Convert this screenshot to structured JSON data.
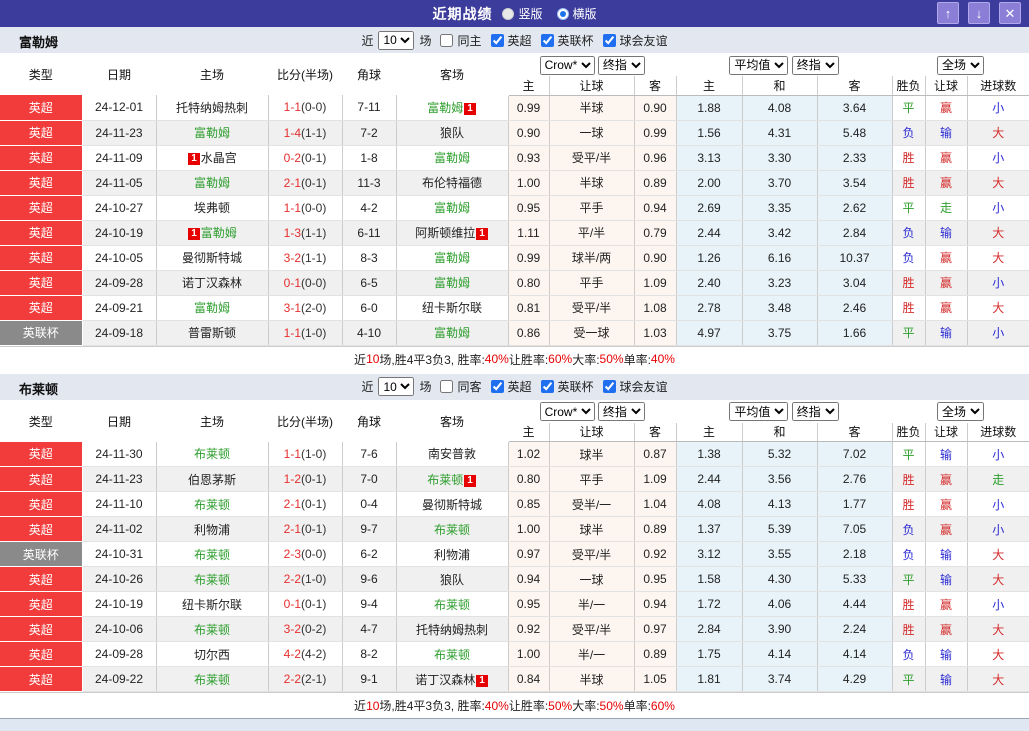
{
  "title_bar": {
    "title": "近期战绩",
    "radios": [
      {
        "label": "竖版",
        "checked": false
      },
      {
        "label": "横版",
        "checked": true
      }
    ],
    "buttons": {
      "up": "↑",
      "down": "↓",
      "close": "✕"
    }
  },
  "colors": {
    "titlebar_bg": "#3c3c9c",
    "epl_red": "#f23c3c",
    "cup_gray": "#8a8a8a",
    "team_green": "#2e9e2e",
    "score_red": "#e62e2e",
    "badge_red": "#e60000",
    "win_red": "#d42b2b",
    "draw_green": "#2e9e2e",
    "lose_blue": "#2b2bd4",
    "odds_bg": "#fdf6f0",
    "avg_bg": "#e7f3f9",
    "header_bg": "#d9e0eb"
  },
  "table_headers": {
    "type": "类型",
    "date": "日期",
    "home": "主场",
    "score": "比分(半场)",
    "corner": "角球",
    "away": "客场",
    "odds_home": "主",
    "odds_handicap": "让球",
    "odds_away": "客",
    "avg_home": "主",
    "avg_draw": "和",
    "avg_away": "客",
    "result_wdl": "胜负",
    "result_handicap": "让球",
    "result_goals": "进球数"
  },
  "dropdowns": {
    "count": "10",
    "bookmaker": "Crow*",
    "final_odds": "终指",
    "average": "平均值",
    "final_odds2": "终指",
    "full_match": "全场"
  },
  "result_color_map": {
    "胜": "#d42b2b",
    "平": "#2e9e2e",
    "负": "#2b2bd4",
    "赢": "#d42b2b",
    "输": "#2b2bd4",
    "走": "#2e9e2e",
    "大": "#d42b2b",
    "小": "#2b2bd4"
  },
  "sections": [
    {
      "team": "富勒姆",
      "near_label": "近",
      "games_label": "场",
      "same_side_label": "同主",
      "same_side_checked": false,
      "leagues": [
        {
          "label": "英超",
          "checked": true
        },
        {
          "label": "英联杯",
          "checked": true
        },
        {
          "label": "球会友谊",
          "checked": true
        }
      ],
      "rows": [
        {
          "type": "英超",
          "date": "24-12-01",
          "home": "托特纳姆热刺",
          "home_color": "black",
          "home_badge": false,
          "score": "1-1",
          "half": "(0-0)",
          "corner": "7-11",
          "away": "富勒姆",
          "away_color": "green",
          "away_badge": true,
          "odds": [
            "0.99",
            "半球",
            "0.90"
          ],
          "avg": [
            "1.88",
            "4.08",
            "3.64"
          ],
          "results": [
            "平",
            "赢",
            "小"
          ]
        },
        {
          "type": "英超",
          "date": "24-11-23",
          "home": "富勒姆",
          "home_color": "green",
          "home_badge": false,
          "score": "1-4",
          "half": "(1-1)",
          "corner": "7-2",
          "away": "狼队",
          "away_color": "black",
          "away_badge": false,
          "odds": [
            "0.90",
            "一球",
            "0.99"
          ],
          "avg": [
            "1.56",
            "4.31",
            "5.48"
          ],
          "results": [
            "负",
            "输",
            "大"
          ]
        },
        {
          "type": "英超",
          "date": "24-11-09",
          "home": "水晶宫",
          "home_color": "black",
          "home_badge": true,
          "score": "0-2",
          "half": "(0-1)",
          "corner": "1-8",
          "away": "富勒姆",
          "away_color": "green",
          "away_badge": false,
          "odds": [
            "0.93",
            "受平/半",
            "0.96"
          ],
          "avg": [
            "3.13",
            "3.30",
            "2.33"
          ],
          "results": [
            "胜",
            "赢",
            "小"
          ]
        },
        {
          "type": "英超",
          "date": "24-11-05",
          "home": "富勒姆",
          "home_color": "green",
          "home_badge": false,
          "score": "2-1",
          "half": "(0-1)",
          "corner": "11-3",
          "away": "布伦特福德",
          "away_color": "black",
          "away_badge": false,
          "odds": [
            "1.00",
            "半球",
            "0.89"
          ],
          "avg": [
            "2.00",
            "3.70",
            "3.54"
          ],
          "results": [
            "胜",
            "赢",
            "大"
          ]
        },
        {
          "type": "英超",
          "date": "24-10-27",
          "home": "埃弗顿",
          "home_color": "black",
          "home_badge": false,
          "score": "1-1",
          "half": "(0-0)",
          "corner": "4-2",
          "away": "富勒姆",
          "away_color": "green",
          "away_badge": false,
          "odds": [
            "0.95",
            "平手",
            "0.94"
          ],
          "avg": [
            "2.69",
            "3.35",
            "2.62"
          ],
          "results": [
            "平",
            "走",
            "小"
          ]
        },
        {
          "type": "英超",
          "date": "24-10-19",
          "home": "富勒姆",
          "home_color": "green",
          "home_badge": true,
          "score": "1-3",
          "half": "(1-1)",
          "corner": "6-11",
          "away": "阿斯顿维拉",
          "away_color": "black",
          "away_badge": true,
          "odds": [
            "1.11",
            "平/半",
            "0.79"
          ],
          "avg": [
            "2.44",
            "3.42",
            "2.84"
          ],
          "results": [
            "负",
            "输",
            "大"
          ]
        },
        {
          "type": "英超",
          "date": "24-10-05",
          "home": "曼彻斯特城",
          "home_color": "black",
          "home_badge": false,
          "score": "3-2",
          "half": "(1-1)",
          "corner": "8-3",
          "away": "富勒姆",
          "away_color": "green",
          "away_badge": false,
          "odds": [
            "0.99",
            "球半/两",
            "0.90"
          ],
          "avg": [
            "1.26",
            "6.16",
            "10.37"
          ],
          "results": [
            "负",
            "赢",
            "大"
          ]
        },
        {
          "type": "英超",
          "date": "24-09-28",
          "home": "诺丁汉森林",
          "home_color": "black",
          "home_badge": false,
          "score": "0-1",
          "half": "(0-0)",
          "corner": "6-5",
          "away": "富勒姆",
          "away_color": "green",
          "away_badge": false,
          "odds": [
            "0.80",
            "平手",
            "1.09"
          ],
          "avg": [
            "2.40",
            "3.23",
            "3.04"
          ],
          "results": [
            "胜",
            "赢",
            "小"
          ]
        },
        {
          "type": "英超",
          "date": "24-09-21",
          "home": "富勒姆",
          "home_color": "green",
          "home_badge": false,
          "score": "3-1",
          "half": "(2-0)",
          "corner": "6-0",
          "away": "纽卡斯尔联",
          "away_color": "black",
          "away_badge": false,
          "odds": [
            "0.81",
            "受平/半",
            "1.08"
          ],
          "avg": [
            "2.78",
            "3.48",
            "2.46"
          ],
          "results": [
            "胜",
            "赢",
            "大"
          ]
        },
        {
          "type": "英联杯",
          "date": "24-09-18",
          "home": "普雷斯顿",
          "home_color": "black",
          "home_badge": false,
          "score": "1-1",
          "half": "(1-0)",
          "corner": "4-10",
          "away": "富勒姆",
          "away_color": "green",
          "away_badge": false,
          "odds": [
            "0.86",
            "受一球",
            "1.03"
          ],
          "avg": [
            "4.97",
            "3.75",
            "1.66"
          ],
          "results": [
            "平",
            "输",
            "小"
          ]
        }
      ],
      "summary": [
        {
          "t": "近"
        },
        {
          "t": "10",
          "red": true
        },
        {
          "t": "场,胜4平3负3, 胜率:"
        },
        {
          "t": "40%",
          "red": true
        },
        {
          "t": " 让胜率:"
        },
        {
          "t": "60%",
          "red": true
        },
        {
          "t": " 大率:"
        },
        {
          "t": "50%",
          "red": true
        },
        {
          "t": " 单率:"
        },
        {
          "t": "40%",
          "red": true
        }
      ]
    },
    {
      "team": "布莱顿",
      "near_label": "近",
      "games_label": "场",
      "same_side_label": "同客",
      "same_side_checked": false,
      "leagues": [
        {
          "label": "英超",
          "checked": true
        },
        {
          "label": "英联杯",
          "checked": true
        },
        {
          "label": "球会友谊",
          "checked": true
        }
      ],
      "rows": [
        {
          "type": "英超",
          "date": "24-11-30",
          "home": "布莱顿",
          "home_color": "green",
          "home_badge": false,
          "score": "1-1",
          "half": "(1-0)",
          "corner": "7-6",
          "away": "南安普敦",
          "away_color": "black",
          "away_badge": false,
          "odds": [
            "1.02",
            "球半",
            "0.87"
          ],
          "avg": [
            "1.38",
            "5.32",
            "7.02"
          ],
          "results": [
            "平",
            "输",
            "小"
          ]
        },
        {
          "type": "英超",
          "date": "24-11-23",
          "home": "伯恩茅斯",
          "home_color": "black",
          "home_badge": false,
          "score": "1-2",
          "half": "(0-1)",
          "corner": "7-0",
          "away": "布莱顿",
          "away_color": "green",
          "away_badge": true,
          "odds": [
            "0.80",
            "平手",
            "1.09"
          ],
          "avg": [
            "2.44",
            "3.56",
            "2.76"
          ],
          "results": [
            "胜",
            "赢",
            "走"
          ]
        },
        {
          "type": "英超",
          "date": "24-11-10",
          "home": "布莱顿",
          "home_color": "green",
          "home_badge": false,
          "score": "2-1",
          "half": "(0-1)",
          "corner": "0-4",
          "away": "曼彻斯特城",
          "away_color": "black",
          "away_badge": false,
          "odds": [
            "0.85",
            "受半/一",
            "1.04"
          ],
          "avg": [
            "4.08",
            "4.13",
            "1.77"
          ],
          "results": [
            "胜",
            "赢",
            "小"
          ]
        },
        {
          "type": "英超",
          "date": "24-11-02",
          "home": "利物浦",
          "home_color": "black",
          "home_badge": false,
          "score": "2-1",
          "half": "(0-1)",
          "corner": "9-7",
          "away": "布莱顿",
          "away_color": "green",
          "away_badge": false,
          "odds": [
            "1.00",
            "球半",
            "0.89"
          ],
          "avg": [
            "1.37",
            "5.39",
            "7.05"
          ],
          "results": [
            "负",
            "赢",
            "小"
          ]
        },
        {
          "type": "英联杯",
          "date": "24-10-31",
          "home": "布莱顿",
          "home_color": "green",
          "home_badge": false,
          "score": "2-3",
          "half": "(0-0)",
          "corner": "6-2",
          "away": "利物浦",
          "away_color": "black",
          "away_badge": false,
          "odds": [
            "0.97",
            "受平/半",
            "0.92"
          ],
          "avg": [
            "3.12",
            "3.55",
            "2.18"
          ],
          "results": [
            "负",
            "输",
            "大"
          ]
        },
        {
          "type": "英超",
          "date": "24-10-26",
          "home": "布莱顿",
          "home_color": "green",
          "home_badge": false,
          "score": "2-2",
          "half": "(1-0)",
          "corner": "9-6",
          "away": "狼队",
          "away_color": "black",
          "away_badge": false,
          "odds": [
            "0.94",
            "一球",
            "0.95"
          ],
          "avg": [
            "1.58",
            "4.30",
            "5.33"
          ],
          "results": [
            "平",
            "输",
            "大"
          ]
        },
        {
          "type": "英超",
          "date": "24-10-19",
          "home": "纽卡斯尔联",
          "home_color": "black",
          "home_badge": false,
          "score": "0-1",
          "half": "(0-1)",
          "corner": "9-4",
          "away": "布莱顿",
          "away_color": "green",
          "away_badge": false,
          "odds": [
            "0.95",
            "半/一",
            "0.94"
          ],
          "avg": [
            "1.72",
            "4.06",
            "4.44"
          ],
          "results": [
            "胜",
            "赢",
            "小"
          ]
        },
        {
          "type": "英超",
          "date": "24-10-06",
          "home": "布莱顿",
          "home_color": "green",
          "home_badge": false,
          "score": "3-2",
          "half": "(0-2)",
          "corner": "4-7",
          "away": "托特纳姆热刺",
          "away_color": "black",
          "away_badge": false,
          "odds": [
            "0.92",
            "受平/半",
            "0.97"
          ],
          "avg": [
            "2.84",
            "3.90",
            "2.24"
          ],
          "results": [
            "胜",
            "赢",
            "大"
          ]
        },
        {
          "type": "英超",
          "date": "24-09-28",
          "home": "切尔西",
          "home_color": "black",
          "home_badge": false,
          "score": "4-2",
          "half": "(4-2)",
          "corner": "8-2",
          "away": "布莱顿",
          "away_color": "green",
          "away_badge": false,
          "odds": [
            "1.00",
            "半/一",
            "0.89"
          ],
          "avg": [
            "1.75",
            "4.14",
            "4.14"
          ],
          "results": [
            "负",
            "输",
            "大"
          ]
        },
        {
          "type": "英超",
          "date": "24-09-22",
          "home": "布莱顿",
          "home_color": "green",
          "home_badge": false,
          "score": "2-2",
          "half": "(2-1)",
          "corner": "9-1",
          "away": "诺丁汉森林",
          "away_color": "black",
          "away_badge": true,
          "odds": [
            "0.84",
            "半球",
            "1.05"
          ],
          "avg": [
            "1.81",
            "3.74",
            "4.29"
          ],
          "results": [
            "平",
            "输",
            "大"
          ]
        }
      ],
      "summary": [
        {
          "t": "近"
        },
        {
          "t": "10",
          "red": true
        },
        {
          "t": "场,胜4平3负3, 胜率:"
        },
        {
          "t": "40%",
          "red": true
        },
        {
          "t": " 让胜率:"
        },
        {
          "t": "50%",
          "red": true
        },
        {
          "t": " 大率:"
        },
        {
          "t": "50%",
          "red": true
        },
        {
          "t": " 单率:"
        },
        {
          "t": "60%",
          "red": true
        }
      ]
    }
  ]
}
